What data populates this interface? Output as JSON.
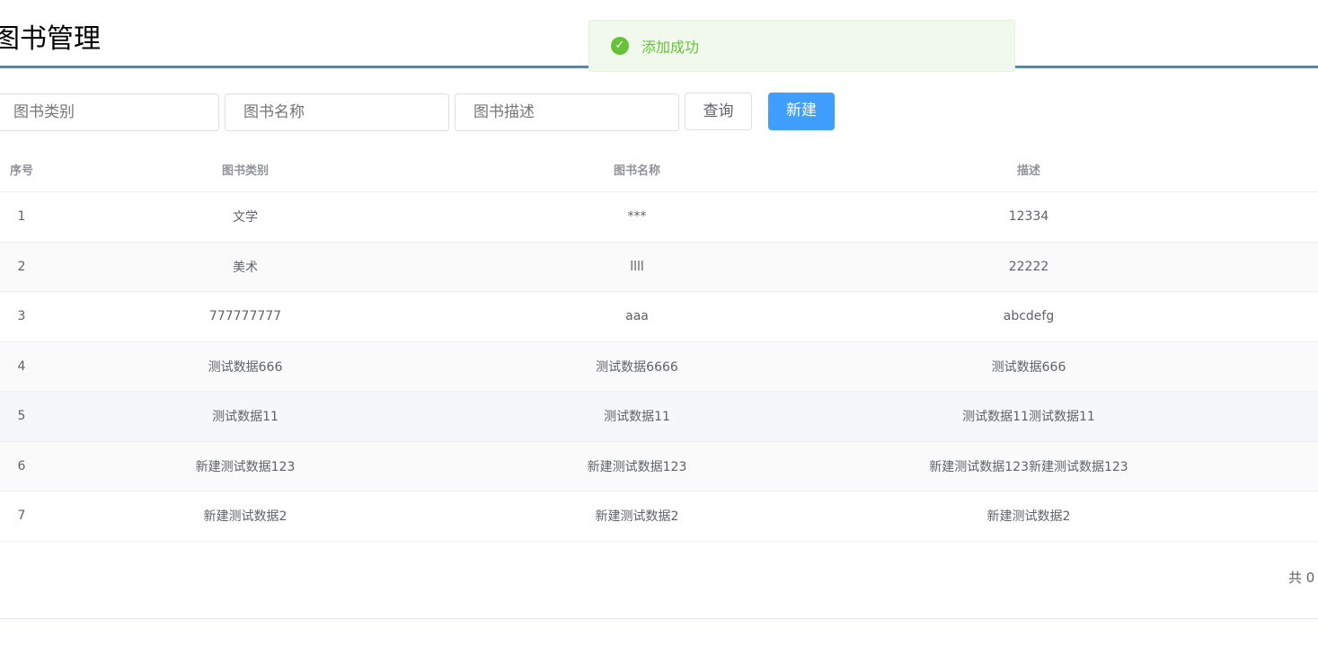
{
  "title": "图书管理",
  "toast": {
    "message": "添加成功",
    "icon": "check-circle-icon",
    "color": "#67c23a"
  },
  "search": {
    "category_placeholder": "图书类别",
    "name_placeholder": "图书名称",
    "desc_placeholder": "图书描述",
    "query_label": "查询",
    "new_label": "新建"
  },
  "table": {
    "headers": [
      "序号",
      "图书类别",
      "图书名称",
      "描述"
    ],
    "rows": [
      [
        "1",
        "文学",
        "***",
        "12334"
      ],
      [
        "2",
        "美术",
        "llll",
        "22222"
      ],
      [
        "3",
        "777777777",
        "aaa",
        "abcdefg"
      ],
      [
        "4",
        "测试数据666",
        "测试数据6666",
        "测试数据666"
      ],
      [
        "5",
        "测试数据11",
        "测试数据11",
        "测试数据11测试数据11"
      ],
      [
        "6",
        "新建测试数据123",
        "新建测试数据123",
        "新建测试数据123新建测试数据123"
      ],
      [
        "7",
        "新建测试数据2",
        "新建测试数据2",
        "新建测试数据2"
      ]
    ]
  },
  "pagination": {
    "total_text": "共 0"
  }
}
